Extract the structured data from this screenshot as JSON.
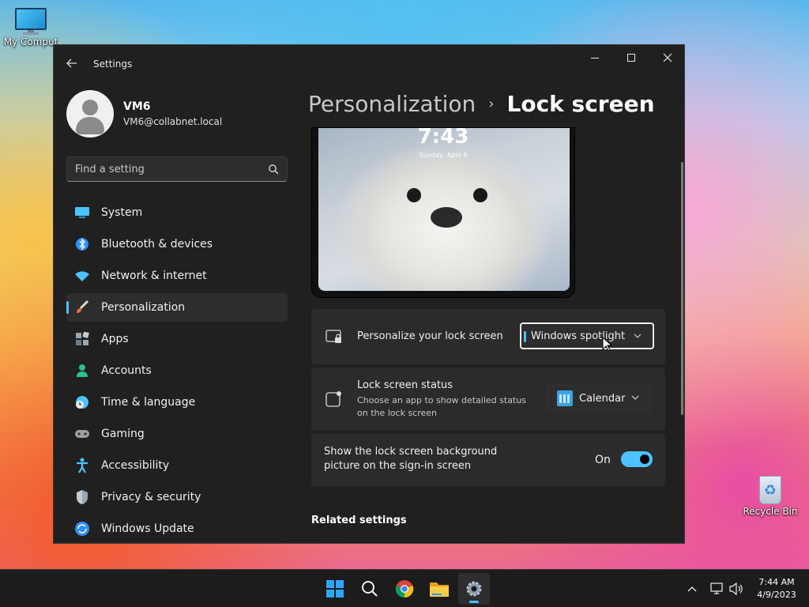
{
  "desktop": {
    "icons": [
      {
        "label": "My Comput"
      },
      {
        "label": "Recycle Bin"
      }
    ]
  },
  "window": {
    "title": "Settings",
    "controls": {
      "minimize": "Minimize",
      "maximize": "Maximize",
      "close": "Close"
    }
  },
  "profile": {
    "name": "VM6",
    "email": "VM6@collabnet.local"
  },
  "search": {
    "placeholder": "Find a setting"
  },
  "sidebar": {
    "items": [
      {
        "label": "System",
        "icon": "monitor-icon",
        "color": "#4cc2ff"
      },
      {
        "label": "Bluetooth & devices",
        "icon": "bluetooth-icon",
        "color": "#2f8ff5"
      },
      {
        "label": "Network & internet",
        "icon": "wifi-icon",
        "color": "#4cc2ff"
      },
      {
        "label": "Personalization",
        "icon": "paintbrush-icon",
        "color": "#e0704a",
        "active": true
      },
      {
        "label": "Apps",
        "icon": "apps-icon",
        "color": "#9aa5b1"
      },
      {
        "label": "Accounts",
        "icon": "person-icon",
        "color": "#2bc48a"
      },
      {
        "label": "Time & language",
        "icon": "clock-globe-icon",
        "color": "#4cc2ff"
      },
      {
        "label": "Gaming",
        "icon": "gamepad-icon",
        "color": "#a0a0a0"
      },
      {
        "label": "Accessibility",
        "icon": "accessibility-icon",
        "color": "#4cc2ff"
      },
      {
        "label": "Privacy & security",
        "icon": "shield-icon",
        "color": "#9aa5b1"
      },
      {
        "label": "Windows Update",
        "icon": "update-icon",
        "color": "#2f8ff5"
      }
    ]
  },
  "breadcrumb": {
    "parent": "Personalization",
    "separator": "›",
    "current": "Lock screen"
  },
  "preview": {
    "time": "7:43",
    "date": "Sunday, April 9"
  },
  "settings": {
    "personalize": {
      "label": "Personalize your lock screen",
      "value": "Windows spotlight"
    },
    "status": {
      "label": "Lock screen status",
      "description": "Choose an app to show detailed status on the lock screen",
      "value": "Calendar"
    },
    "background": {
      "label": "Show the lock screen background picture on the sign-in screen",
      "state": "On",
      "enabled": true
    }
  },
  "related": {
    "heading": "Related settings"
  },
  "taskbar": {
    "apps": [
      "start-icon",
      "search-icon",
      "chrome-icon",
      "file-explorer-icon",
      "settings-icon"
    ],
    "tray": {
      "time": "7:44 AM",
      "date": "4/9/2023"
    }
  },
  "colors": {
    "accent": "#4cc2ff",
    "window_bg": "#202020",
    "card_bg": "#2b2b2b"
  }
}
